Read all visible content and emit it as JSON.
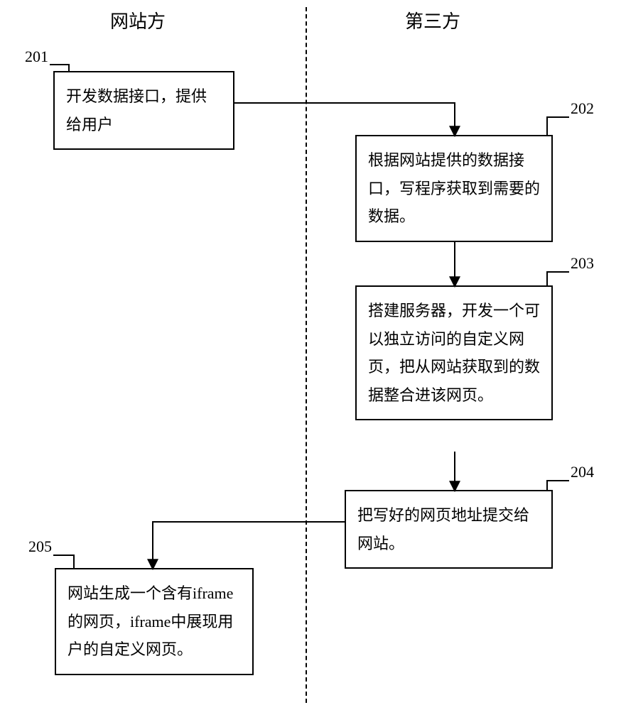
{
  "headers": {
    "left": "网站方",
    "right": "第三方"
  },
  "steps": {
    "s201": {
      "label": "201",
      "text": "开发数据接口，提供给用户"
    },
    "s202": {
      "label": "202",
      "text": "根据网站提供的数据接口，写程序获取到需要的数据。"
    },
    "s203": {
      "label": "203",
      "text": "搭建服务器，开发一个可以独立访问的自定义网页，把从网站获取到的数据整合进该网页。"
    },
    "s204": {
      "label": "204",
      "text": "把写好的网页地址提交给网站。"
    },
    "s205": {
      "label": "205",
      "text": "网站生成一个含有iframe 的网页，iframe中展现用户的自定义网页。"
    }
  }
}
